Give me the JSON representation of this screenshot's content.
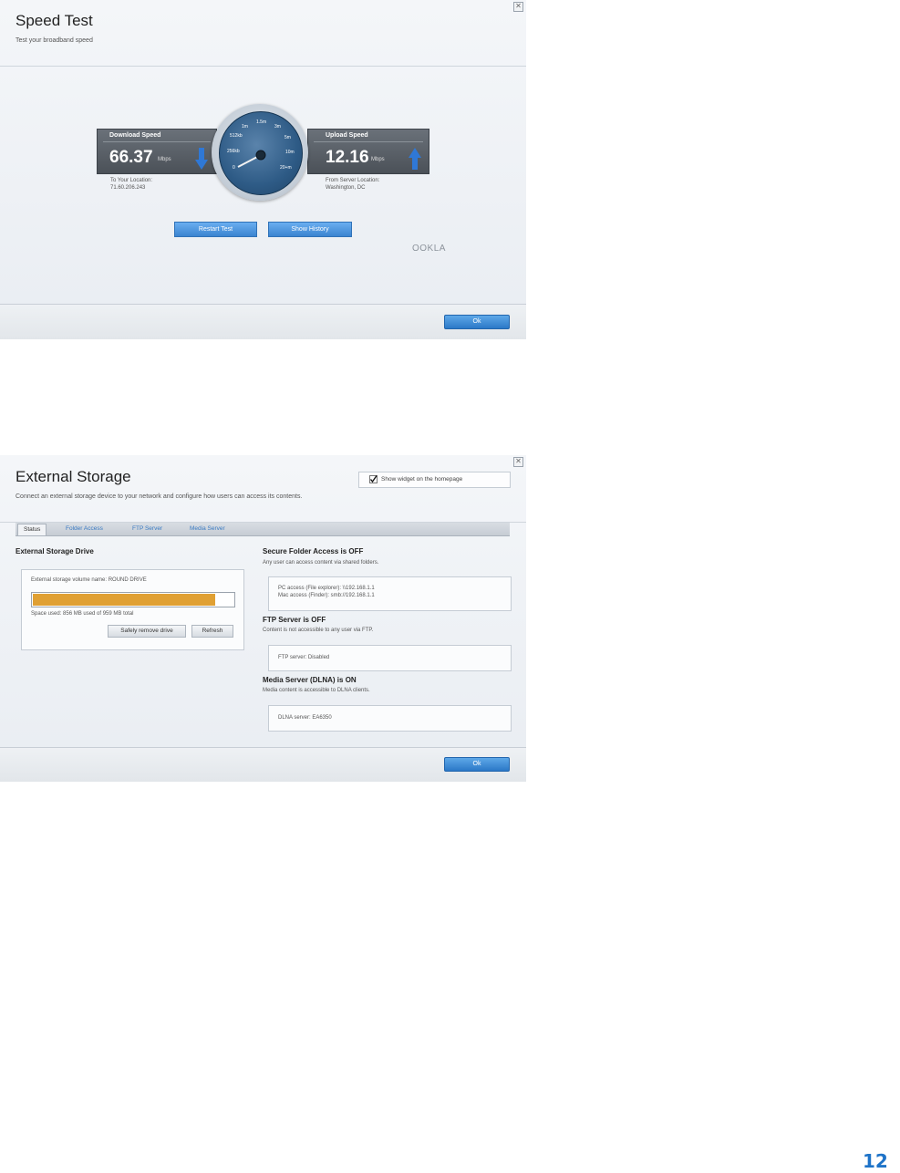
{
  "speed_test": {
    "title": "Speed Test",
    "subtitle": "Test your broadband speed",
    "close_glyph": "✕",
    "download": {
      "caption": "Download Speed",
      "value": "66.37",
      "unit": "Mbps",
      "location_label": "To Your Location:",
      "location_value": "71.60.206.243"
    },
    "upload": {
      "caption": "Upload Speed",
      "value": "12.16",
      "unit": "Mbps",
      "location_label": "From Server Location:",
      "location_value": "Washington, DC"
    },
    "gauge_ticks": [
      "0",
      "256kb",
      "512kb",
      "1m",
      "1.5m",
      "3m",
      "5m",
      "10m",
      "20+m"
    ],
    "restart_label": "Restart Test",
    "history_label": "Show History",
    "brand": "OOKLA",
    "ok_label": "Ok",
    "colors": {
      "accent": "#3a84d0",
      "download_arrow": "#2f78d6",
      "upload_arrow": "#2f78d6"
    }
  },
  "external_storage": {
    "title": "External Storage",
    "subtitle": "Connect an external storage device to your network and configure how users can access its contents.",
    "close_glyph": "✕",
    "show_widget_label": "Show widget on the homepage",
    "show_widget_checked": true,
    "tabs": [
      "Status",
      "Folder Access",
      "FTP Server",
      "Media Server"
    ],
    "drive": {
      "heading": "External Storage Drive",
      "volume_label": "External storage volume name: ROUND DRIVE",
      "used_fraction": 0.91,
      "space_text": "Space used: 856 MB used of 959 MB total",
      "safely_remove_label": "Safely remove drive",
      "refresh_label": "Refresh",
      "bar_color": "#e0a033"
    },
    "secure": {
      "heading": "Secure Folder Access is OFF",
      "desc": "Any user can access content via shared folders.",
      "pc": "PC access (File explorer): \\\\192.168.1.1",
      "mac": "Mac access (Finder): smb://192.168.1.1"
    },
    "ftp": {
      "heading": "FTP Server is OFF",
      "desc": "Content is not accessible to any user via FTP.",
      "value": "FTP server: Disabled"
    },
    "dlna": {
      "heading": "Media Server (DLNA) is ON",
      "desc": "Media content is accessible to DLNA clients.",
      "value": "DLNA server: EA6350"
    },
    "ok_label": "Ok"
  },
  "page_number": "12"
}
